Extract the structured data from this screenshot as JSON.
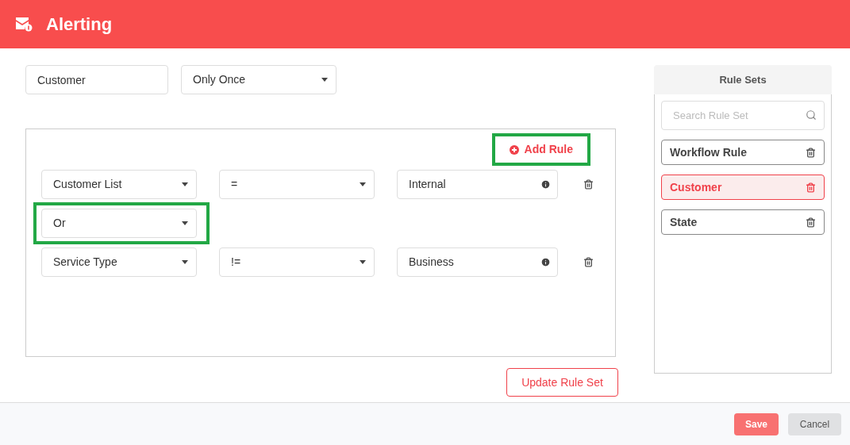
{
  "header": {
    "title": "Alerting"
  },
  "alert": {
    "name": "Customer",
    "frequency": "Only Once"
  },
  "rule_builder": {
    "add_rule": {
      "label": "Add Rule",
      "highlighted": true
    },
    "rows": [
      {
        "kind": "rule",
        "field": "Customer List",
        "operator": "=",
        "value": "Internal"
      },
      {
        "kind": "connector",
        "value": "Or",
        "highlighted": true
      },
      {
        "kind": "rule",
        "field": "Service Type",
        "operator": "!=",
        "value": "Business"
      }
    ]
  },
  "update_button": "Update Rule Set",
  "rule_sets": {
    "title": "Rule Sets",
    "search_placeholder": "Search Rule Set",
    "items": [
      {
        "label": "Workflow Rule",
        "selected": false
      },
      {
        "label": "Customer",
        "selected": true
      },
      {
        "label": "State",
        "selected": false
      }
    ]
  },
  "footer": {
    "save": "Save",
    "cancel": "Cancel"
  }
}
